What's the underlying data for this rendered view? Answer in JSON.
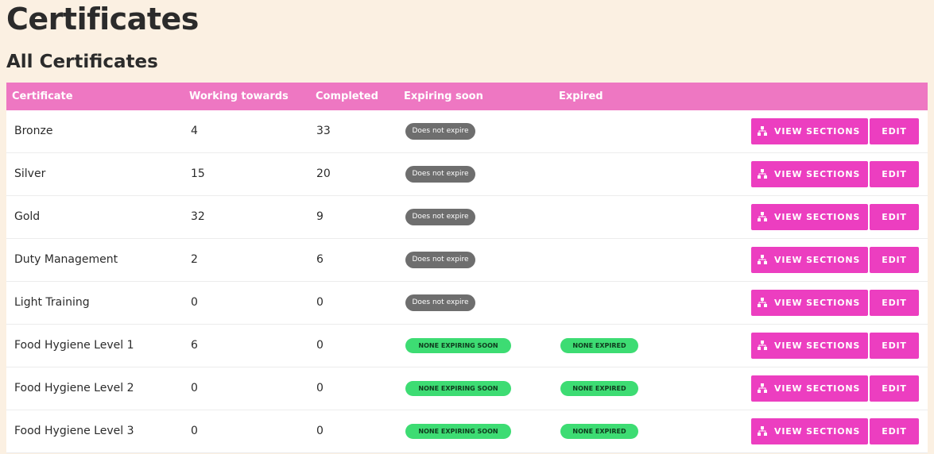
{
  "page": {
    "title": "Certificates",
    "section_title": "All Certificates"
  },
  "table": {
    "headers": {
      "certificate": "Certificate",
      "working_towards": "Working towards",
      "completed": "Completed",
      "expiring_soon": "Expiring soon",
      "expired": "Expired"
    },
    "rows": [
      {
        "name": "Bronze",
        "working": "4",
        "completed": "33",
        "expiring": "Does not expire",
        "expiring_style": "grey",
        "expired": ""
      },
      {
        "name": "Silver",
        "working": "15",
        "completed": "20",
        "expiring": "Does not expire",
        "expiring_style": "grey",
        "expired": ""
      },
      {
        "name": "Gold",
        "working": "32",
        "completed": "9",
        "expiring": "Does not expire",
        "expiring_style": "grey",
        "expired": ""
      },
      {
        "name": "Duty Management",
        "working": "2",
        "completed": "6",
        "expiring": "Does not expire",
        "expiring_style": "grey",
        "expired": ""
      },
      {
        "name": "Light Training",
        "working": "0",
        "completed": "0",
        "expiring": "Does not expire",
        "expiring_style": "grey",
        "expired": ""
      },
      {
        "name": "Food Hygiene Level 1",
        "working": "6",
        "completed": "0",
        "expiring": "NONE EXPIRING SOON",
        "expiring_style": "green",
        "expired": "NONE EXPIRED"
      },
      {
        "name": "Food Hygiene Level 2",
        "working": "0",
        "completed": "0",
        "expiring": "NONE EXPIRING SOON",
        "expiring_style": "green",
        "expired": "NONE EXPIRED"
      },
      {
        "name": "Food Hygiene Level 3",
        "working": "0",
        "completed": "0",
        "expiring": "NONE EXPIRING SOON",
        "expiring_style": "green",
        "expired": "NONE EXPIRED"
      }
    ]
  },
  "actions": {
    "view_sections_label": "VIEW SECTIONS",
    "view_sections_icon": "sitemap-icon",
    "edit_label": "EDIT"
  },
  "colors": {
    "background": "#fbf0e2",
    "header": "#ee77c2",
    "button": "#ec3ec0",
    "badge_grey": "#6e6e6e",
    "badge_green": "#3ddc73"
  }
}
